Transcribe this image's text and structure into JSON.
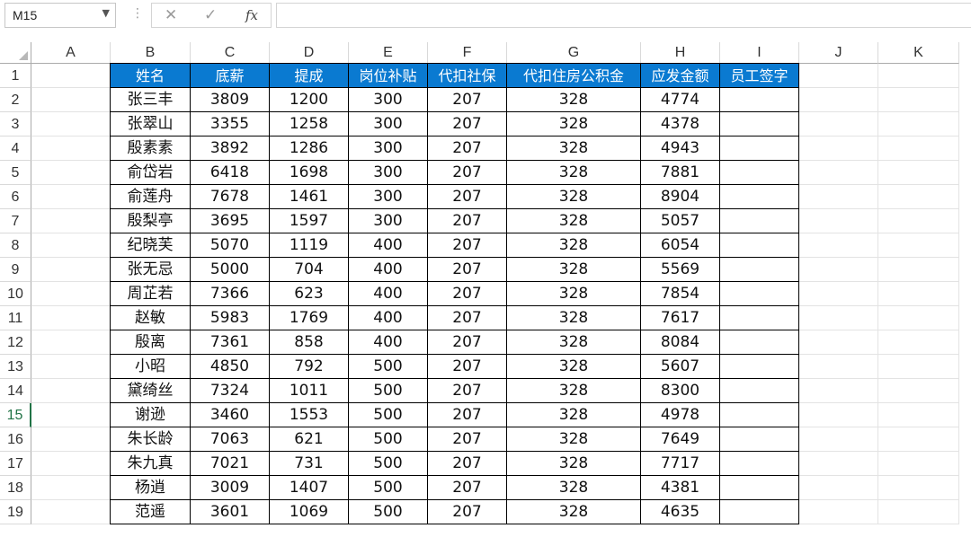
{
  "formula_bar": {
    "name_box": "M15",
    "name_box_arrow": "▼",
    "menu_dots": "⋮",
    "cancel_glyph": "✕",
    "enter_glyph": "✓",
    "fx_label": "fx",
    "formula": ""
  },
  "columns": [
    "A",
    "B",
    "C",
    "D",
    "E",
    "F",
    "G",
    "H",
    "I",
    "J",
    "K"
  ],
  "rows": [
    "1",
    "2",
    "3",
    "4",
    "5",
    "6",
    "7",
    "8",
    "9",
    "10",
    "11",
    "12",
    "13",
    "14",
    "15",
    "16",
    "17",
    "18",
    "19"
  ],
  "active_row": "15",
  "header_fill_color": "#0a7ad1",
  "table": {
    "headers": [
      "姓名",
      "底薪",
      "提成",
      "岗位补贴",
      "代扣社保",
      "代扣住房公积金",
      "应发金额",
      "员工签字"
    ],
    "rows": [
      [
        "张三丰",
        "3809",
        "1200",
        "300",
        "207",
        "328",
        "4774",
        ""
      ],
      [
        "张翠山",
        "3355",
        "1258",
        "300",
        "207",
        "328",
        "4378",
        ""
      ],
      [
        "殷素素",
        "3892",
        "1286",
        "300",
        "207",
        "328",
        "4943",
        ""
      ],
      [
        "俞岱岩",
        "6418",
        "1698",
        "300",
        "207",
        "328",
        "7881",
        ""
      ],
      [
        "俞莲舟",
        "7678",
        "1461",
        "300",
        "207",
        "328",
        "8904",
        ""
      ],
      [
        "殷梨亭",
        "3695",
        "1597",
        "300",
        "207",
        "328",
        "5057",
        ""
      ],
      [
        "纪晓芙",
        "5070",
        "1119",
        "400",
        "207",
        "328",
        "6054",
        ""
      ],
      [
        "张无忌",
        "5000",
        "704",
        "400",
        "207",
        "328",
        "5569",
        ""
      ],
      [
        "周芷若",
        "7366",
        "623",
        "400",
        "207",
        "328",
        "7854",
        ""
      ],
      [
        "赵敏",
        "5983",
        "1769",
        "400",
        "207",
        "328",
        "7617",
        ""
      ],
      [
        "殷离",
        "7361",
        "858",
        "400",
        "207",
        "328",
        "8084",
        ""
      ],
      [
        "小昭",
        "4850",
        "792",
        "500",
        "207",
        "328",
        "5607",
        ""
      ],
      [
        "黛绮丝",
        "7324",
        "1011",
        "500",
        "207",
        "328",
        "8300",
        ""
      ],
      [
        "谢逊",
        "3460",
        "1553",
        "500",
        "207",
        "328",
        "4978",
        ""
      ],
      [
        "朱长龄",
        "7063",
        "621",
        "500",
        "207",
        "328",
        "7649",
        ""
      ],
      [
        "朱九真",
        "7021",
        "731",
        "500",
        "207",
        "328",
        "7717",
        ""
      ],
      [
        "杨逍",
        "3009",
        "1407",
        "500",
        "207",
        "328",
        "4381",
        ""
      ],
      [
        "范遥",
        "3601",
        "1069",
        "500",
        "207",
        "328",
        "4635",
        ""
      ]
    ]
  }
}
